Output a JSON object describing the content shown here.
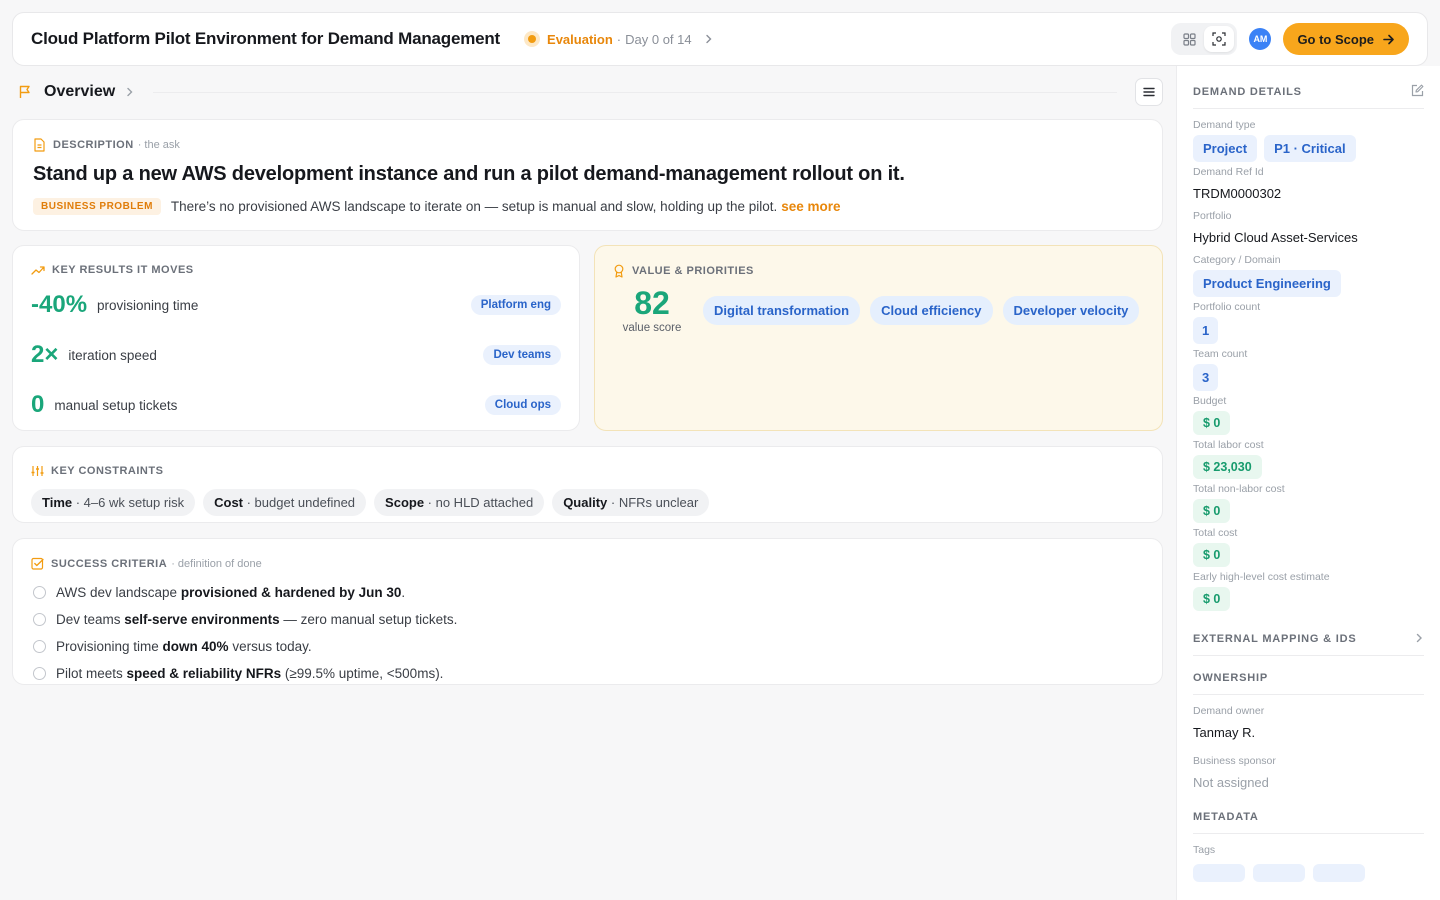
{
  "header": {
    "title": "Cloud Platform Pilot Environment for Demand Management",
    "stage": {
      "name": "Evaluation",
      "separator": "·",
      "day": "Day 0 of 14"
    },
    "avatar_initials": "AM",
    "scope_button": "Go to Scope"
  },
  "overview": {
    "title": "Overview"
  },
  "description": {
    "label": "Description",
    "sub": "· the ask",
    "heading": "Stand up a new AWS development instance and run a pilot demand-management rollout on it.",
    "badge": "BUSINESS PROBLEM",
    "problem": "There’s no provisioned AWS landscape to iterate on — setup is manual and slow, holding up the pilot.",
    "see_more": "see more"
  },
  "key_results": {
    "label": "Key results it moves",
    "items": [
      {
        "value": "-40%",
        "text": "provisioning time",
        "team": "Platform eng"
      },
      {
        "value": "2×",
        "text": "iteration speed",
        "team": "Dev teams"
      },
      {
        "value": "0",
        "text": "manual setup tickets",
        "team": "Cloud ops"
      }
    ]
  },
  "value_priorities": {
    "label": "Value & Priorities",
    "score": "82",
    "score_label": "value score",
    "tags": [
      "Digital transformation",
      "Cloud efficiency",
      "Developer velocity"
    ]
  },
  "constraints": {
    "label": "Key constraints",
    "items": [
      {
        "key": "Time",
        "text": " · 4–6 wk setup risk"
      },
      {
        "key": "Cost",
        "text": " · budget undefined"
      },
      {
        "key": "Scope",
        "text": " · no HLD attached"
      },
      {
        "key": "Quality",
        "text": " · NFRs unclear"
      }
    ]
  },
  "success": {
    "label": "Success criteria",
    "sub": "· definition of done",
    "items": [
      {
        "pre": "AWS dev landscape ",
        "bold": "provisioned & hardened by Jun 30",
        "post": "."
      },
      {
        "pre": "Dev teams ",
        "bold": "self-serve environments",
        "post": " — zero manual setup tickets."
      },
      {
        "pre": "Provisioning time ",
        "bold": "down 40%",
        "post": " versus today."
      },
      {
        "pre": "Pilot meets ",
        "bold": "speed & reliability NFRs",
        "post": " (≥99.5% uptime, <500ms)."
      }
    ]
  },
  "demand_details": {
    "title": "Demand details",
    "demand_type_label": "Demand type",
    "demand_type_chips": [
      "Project",
      "P1 · Critical"
    ],
    "ref_label": "Demand Ref Id",
    "ref_value": "TRDM0000302",
    "portfolio_label": "Portfolio",
    "portfolio_value": "Hybrid Cloud Asset-Services",
    "category_label": "Category / Domain",
    "category_value": "Product Engineering",
    "portfolio_count_label": "Portfolio count",
    "portfolio_count_value": "1",
    "team_count_label": "Team count",
    "team_count_value": "3",
    "budget_label": "Budget",
    "budget_value": "$ 0",
    "labor_label": "Total labor cost",
    "labor_value": "$ 23,030",
    "nonlabor_label": "Total non-labor cost",
    "nonlabor_value": "$ 0",
    "total_label": "Total cost",
    "total_value": "$ 0",
    "early_label": "Early high-level cost estimate",
    "early_value": "$ 0"
  },
  "external_mapping": {
    "title": "External mapping & IDs"
  },
  "ownership": {
    "title": "Ownership",
    "owner_label": "Demand owner",
    "owner_value": "Tanmay R.",
    "sponsor_label": "Business sponsor",
    "sponsor_value": "Not assigned"
  },
  "metadata": {
    "title": "Metadata",
    "tags_label": "Tags"
  },
  "colors": {
    "accent": "#f8a61c",
    "positive": "#1aa67a",
    "link_blue": "#2a64c9"
  }
}
